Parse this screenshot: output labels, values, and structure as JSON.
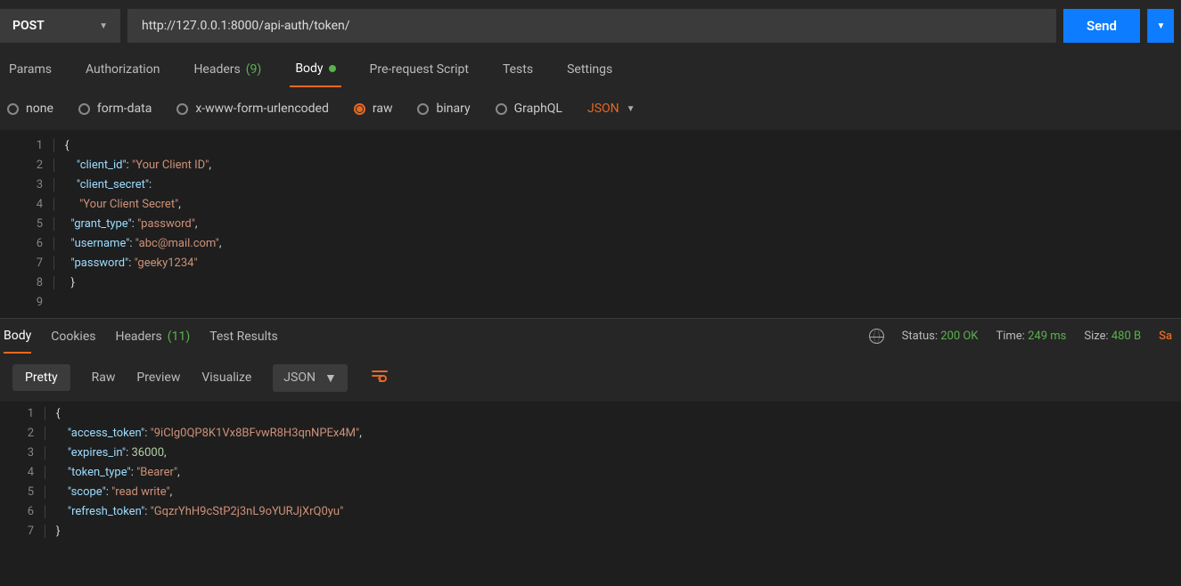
{
  "request": {
    "method": "POST",
    "url": "http://127.0.0.1:8000/api-auth/token/",
    "send": "Send"
  },
  "tabs": {
    "params": "Params",
    "authorization": "Authorization",
    "headers": "Headers",
    "headers_count": "(9)",
    "body": "Body",
    "pre_request": "Pre-request Script",
    "tests": "Tests",
    "settings": "Settings"
  },
  "body_types": {
    "none": "none",
    "form_data": "form-data",
    "xwww": "x-www-form-urlencoded",
    "raw": "raw",
    "binary": "binary",
    "graphql": "GraphQL",
    "content_type": "JSON"
  },
  "request_body_lines": [
    "1",
    "2",
    "3",
    "4",
    "5",
    "6",
    "7",
    "8",
    "9"
  ],
  "request_body": {
    "client_id": "Your Client ID",
    "client_secret": "Your Client Secret",
    "grant_type": "password",
    "username": "abc@mail.com",
    "password": "geeky1234"
  },
  "response": {
    "tabs": {
      "body": "Body",
      "cookies": "Cookies",
      "headers": "Headers",
      "headers_count": "(11)",
      "test_results": "Test Results"
    },
    "status_label": "Status:",
    "status": "200 OK",
    "time_label": "Time:",
    "time": "249 ms",
    "size_label": "Size:",
    "size": "480 B",
    "save": "Sa",
    "views": {
      "pretty": "Pretty",
      "raw": "Raw",
      "preview": "Preview",
      "visualize": "Visualize",
      "json": "JSON"
    },
    "body_lines": [
      "1",
      "2",
      "3",
      "4",
      "5",
      "6",
      "7"
    ],
    "body": {
      "access_token": "9iClg0QP8K1Vx8BFvwR8H3qnNPEx4M",
      "expires_in": 36000,
      "token_type": "Bearer",
      "scope": "read write",
      "refresh_token": "GqzrYhH9cStP2j3nL9oYURJjXrQ0yu"
    }
  }
}
